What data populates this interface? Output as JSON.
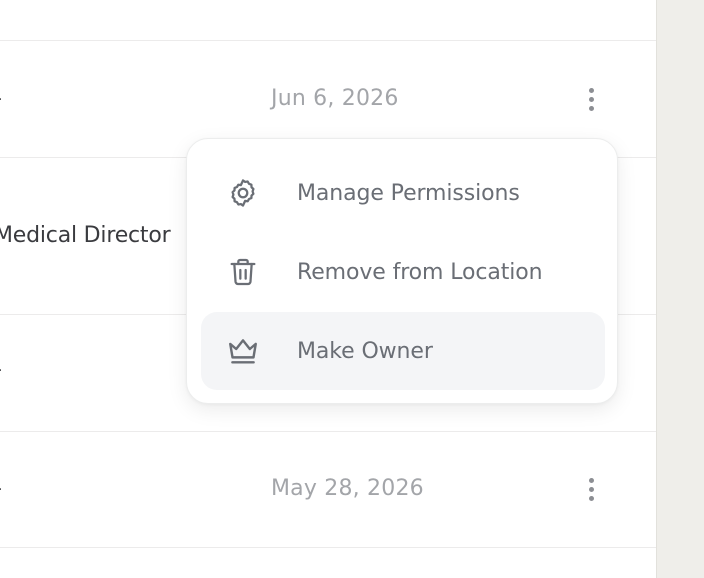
{
  "rows": [
    {
      "role": "-",
      "date": "Jun 6, 2026"
    },
    {
      "role": "Medical Director",
      "date": ""
    },
    {
      "role": "-",
      "date": ""
    },
    {
      "role": "-",
      "date": "May 28, 2026"
    }
  ],
  "menu": {
    "items": [
      {
        "label": "Manage Permissions",
        "icon": "gear-icon"
      },
      {
        "label": "Remove from Location",
        "icon": "trash-icon"
      },
      {
        "label": "Make Owner",
        "icon": "crown-icon"
      }
    ]
  },
  "colors": {
    "sidebar_bg": "#efeeea",
    "menu_text": "#6a6e75",
    "date_text": "#a3a5a9",
    "highlight_bg": "#f4f5f7"
  }
}
